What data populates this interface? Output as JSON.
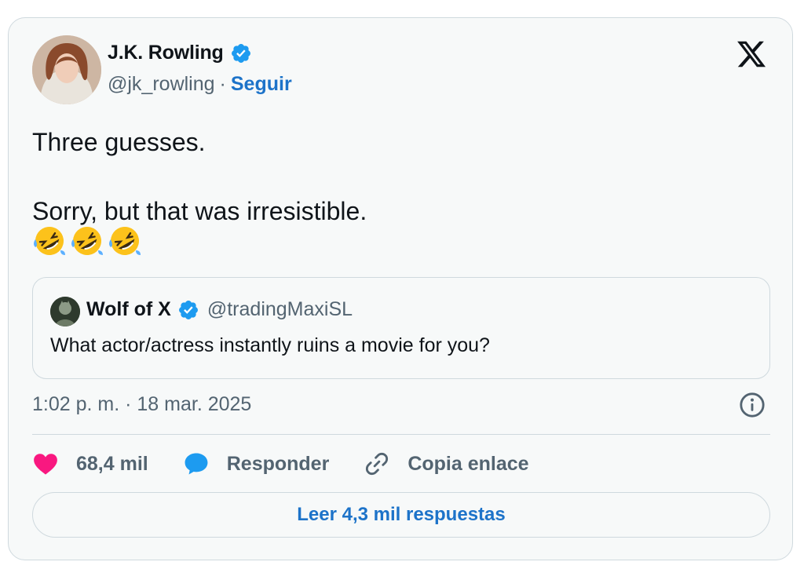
{
  "author": {
    "display_name": "J.K. Rowling",
    "handle": "@jk_rowling",
    "separator": "·",
    "follow_label": "Seguir",
    "avatar_icon": "profile-photo"
  },
  "tweet": {
    "lines": [
      "Three guesses.",
      "",
      "Sorry, but that was irresistible."
    ],
    "emojis": [
      "rolling-on-floor-laughing-icon",
      "rolling-on-floor-laughing-icon",
      "rolling-on-floor-laughing-icon"
    ]
  },
  "quote": {
    "display_name": "Wolf of X",
    "handle": "@tradingMaxiSL",
    "text": "What actor/actress instantly ruins a movie for you?"
  },
  "timestamp": "1:02 p. m. · 18 mar. 2025",
  "actions": {
    "like_count": "68,4 mil",
    "reply_label": "Responder",
    "copy_link_label": "Copia enlace"
  },
  "read_replies_label": "Leer 4,3 mil respuestas",
  "colors": {
    "accent": "#1d73c9",
    "verified": "#1d9bf0",
    "like": "#f91880",
    "reply": "#1d9bf0",
    "muted": "#536471",
    "border": "#cfd9de"
  }
}
